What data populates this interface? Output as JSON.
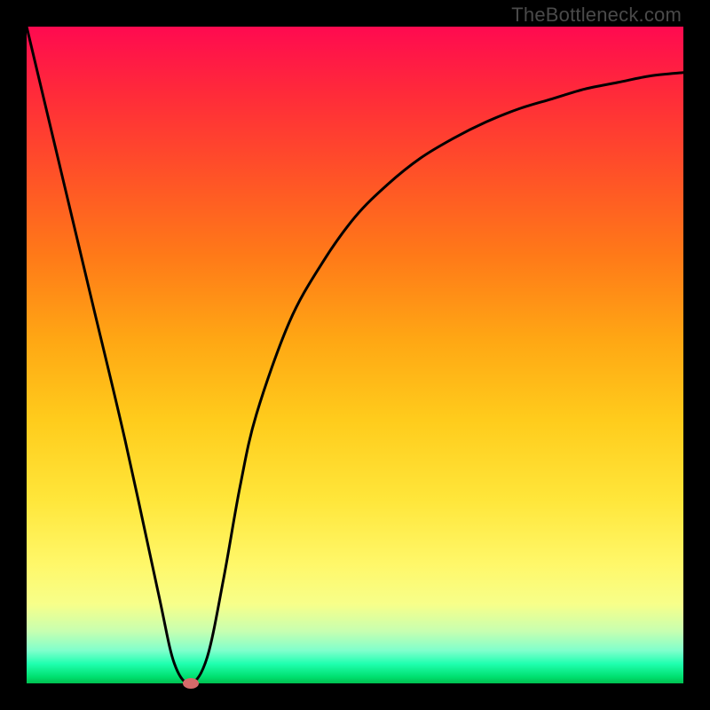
{
  "brand": "TheBottleneck.com",
  "chart_data": {
    "type": "line",
    "title": "",
    "xlabel": "",
    "ylabel": "",
    "xlim": [
      0,
      1
    ],
    "ylim": [
      0,
      1
    ],
    "series": [
      {
        "name": "curve",
        "x": [
          0.0,
          0.05,
          0.1,
          0.15,
          0.2,
          0.225,
          0.25,
          0.275,
          0.3,
          0.325,
          0.35,
          0.4,
          0.45,
          0.5,
          0.55,
          0.6,
          0.65,
          0.7,
          0.75,
          0.8,
          0.85,
          0.9,
          0.95,
          1.0
        ],
        "values": [
          1.0,
          0.79,
          0.58,
          0.37,
          0.14,
          0.03,
          0.0,
          0.04,
          0.16,
          0.3,
          0.41,
          0.55,
          0.64,
          0.71,
          0.76,
          0.8,
          0.83,
          0.855,
          0.875,
          0.89,
          0.905,
          0.915,
          0.925,
          0.93
        ]
      }
    ],
    "marker": {
      "x": 0.25,
      "y": 0.0,
      "color": "#d66a6a",
      "label": "min-point"
    }
  }
}
